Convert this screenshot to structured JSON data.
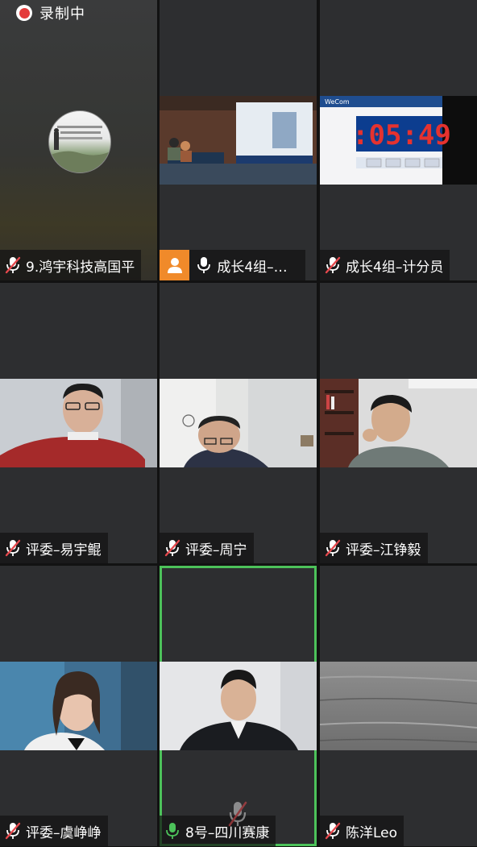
{
  "recording": {
    "label": "录制中"
  },
  "tiles": [
    {
      "name": "9.鸿宇科技高国平",
      "mic": "muted"
    },
    {
      "name": "成长4组–组...",
      "mic": "on"
    },
    {
      "name": "成长4组–计分员",
      "mic": "muted"
    },
    {
      "name": "评委–易宇鲲",
      "mic": "muted"
    },
    {
      "name": "评委–周宁",
      "mic": "muted"
    },
    {
      "name": "评委–江铮毅",
      "mic": "muted"
    },
    {
      "name": "评委–虞峥峥",
      "mic": "muted"
    },
    {
      "name": "8号–四川赛康",
      "mic": "speaking"
    },
    {
      "name": "陈洋Leo",
      "mic": "muted"
    }
  ],
  "timer_screen": {
    "brand": "WeCom",
    "time": ":05:49"
  },
  "colors": {
    "speaking_border": "#4cc25a",
    "tile_bg": "#2d2e30",
    "record_red": "#e43b3b",
    "avatar_orange": "#f08a2a"
  }
}
